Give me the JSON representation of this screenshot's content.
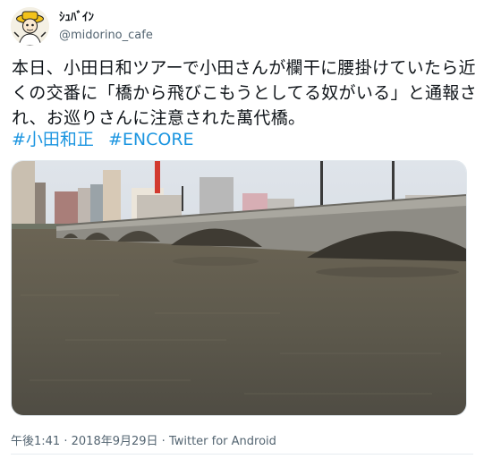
{
  "user": {
    "display_name": "ｼｭﾊﾞｲﾝ",
    "handle": "@midorino_cafe"
  },
  "tweet": {
    "text": "本日、小田日和ツアーで小田さんが欄干に腰掛けていたら近くの交番に「橋から飛びこもうとしてる奴がいる」と通報され、お巡りさんに注意された萬代橋。",
    "hashtags": [
      "#小田和正",
      "#ENCORE"
    ],
    "time": "午後1:41",
    "separator1": "·",
    "date": "2018年9月29日",
    "separator2": "·",
    "source": "Twitter for Android"
  },
  "colors": {
    "link": "#1b95e0",
    "text": "#0f1419",
    "muted": "#536471"
  },
  "media": {
    "icon": "bridge-photo"
  }
}
